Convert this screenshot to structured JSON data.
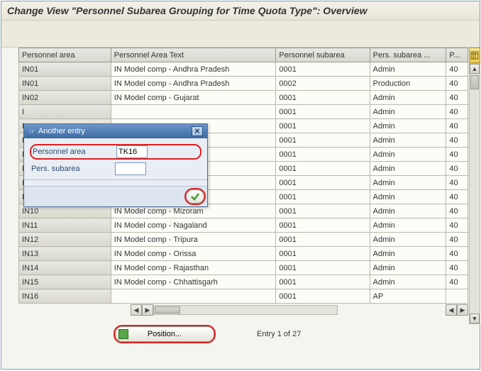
{
  "window": {
    "title": "Change View \"Personnel Subarea Grouping for Time Quota Type\": Overview"
  },
  "table": {
    "headers": {
      "c0": "Personnel area",
      "c1": "Personnel Area Text",
      "c2": "Personnel subarea",
      "c3": "Pers. subarea ...",
      "c4": "P..."
    },
    "rows": [
      {
        "c0": "IN01",
        "c1": "IN Model comp - Andhra Pradesh",
        "c2": "0001",
        "c3": "Admin",
        "c4": "40"
      },
      {
        "c0": "IN01",
        "c1": "IN Model comp - Andhra Pradesh",
        "c2": "0002",
        "c3": "Production",
        "c4": "40"
      },
      {
        "c0": "IN02",
        "c1": "IN Model comp - Gujarat",
        "c2": "0001",
        "c3": "Admin",
        "c4": "40"
      },
      {
        "c0": "I",
        "c1": "",
        "c2": "0001",
        "c3": "Admin",
        "c4": "40"
      },
      {
        "c0": "I",
        "c1": "",
        "c2": "0001",
        "c3": "Admin",
        "c4": "40"
      },
      {
        "c0": "I",
        "c1": "esh",
        "c2": "0001",
        "c3": "Admin",
        "c4": "40"
      },
      {
        "c0": "I",
        "c1": "",
        "c2": "0001",
        "c3": "Admin",
        "c4": "40"
      },
      {
        "c0": "I",
        "c1": "",
        "c2": "0001",
        "c3": "Admin",
        "c4": "40"
      },
      {
        "c0": "I",
        "c1": "",
        "c2": "0001",
        "c3": "Admin",
        "c4": "40"
      },
      {
        "c0": "I",
        "c1": "",
        "c2": "0001",
        "c3": "Admin",
        "c4": "40"
      },
      {
        "c0": "IN10",
        "c1": "IN Model comp - Mizoram",
        "c2": "0001",
        "c3": "Admin",
        "c4": "40"
      },
      {
        "c0": "IN11",
        "c1": "IN Model comp - Nagaland",
        "c2": "0001",
        "c3": "Admin",
        "c4": "40"
      },
      {
        "c0": "IN12",
        "c1": "IN Model comp - Tripura",
        "c2": "0001",
        "c3": "Admin",
        "c4": "40"
      },
      {
        "c0": "IN13",
        "c1": "IN Model comp - Orissa",
        "c2": "0001",
        "c3": "Admin",
        "c4": "40"
      },
      {
        "c0": "IN14",
        "c1": "IN Model comp - Rajasthan",
        "c2": "0001",
        "c3": "Admin",
        "c4": "40"
      },
      {
        "c0": "IN15",
        "c1": "IN Model comp - Chhattisgarh",
        "c2": "0001",
        "c3": "Admin",
        "c4": "40"
      },
      {
        "c0": "IN16",
        "c1": "",
        "c2": "0001",
        "c3": "AP",
        "c4": ""
      }
    ]
  },
  "dialog": {
    "title": "Another entry",
    "labels": {
      "parea": "Personnel area",
      "psub": "Pers. subarea"
    },
    "values": {
      "parea": "TK16",
      "psub": ""
    }
  },
  "footer": {
    "position_label": "Position...",
    "entry_text": "Entry 1 of 27"
  }
}
